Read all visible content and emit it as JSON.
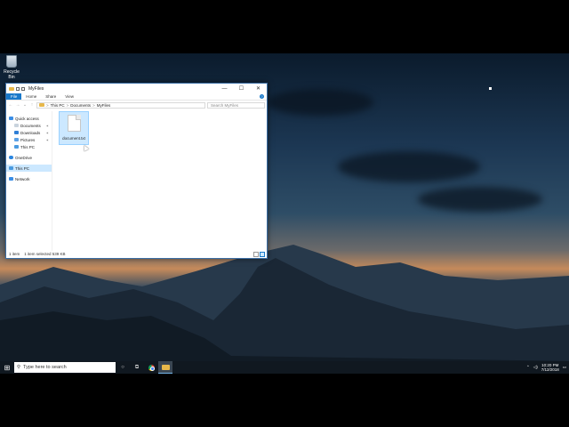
{
  "desktop": {
    "recycle_bin_label": "Recycle Bin"
  },
  "explorer": {
    "title": "MyFiles",
    "window_controls": {
      "minimize": "—",
      "maximize": "☐",
      "close": "✕"
    },
    "ribbon_tabs": [
      "File",
      "Home",
      "Share",
      "View"
    ],
    "help_glyph": "?",
    "nav_glyphs": {
      "back": "←",
      "forward": "→",
      "up_menu": "⌄",
      "up": "↑"
    },
    "address_parts": [
      "This PC",
      "Documents",
      "MyFiles"
    ],
    "address_sep": ">",
    "search_placeholder": "Search MyFiles",
    "nav_items": {
      "quick_access": "Quick access",
      "documents": "Documents",
      "downloads": "Downloads",
      "pictures": "Pictures",
      "this_pc_quick": "This PC",
      "onedrive": "OneDrive",
      "this_pc": "This PC",
      "network": "Network"
    },
    "file": {
      "name": "document.txt"
    },
    "status": {
      "item_count": "1 item",
      "selected": "1 item selected 539 KB"
    }
  },
  "taskbar": {
    "start_glyph": "⊞",
    "search_placeholder": "Type here to search",
    "cortana_glyph": "○",
    "taskview_glyph": "⧉",
    "clock_time": "10:20 PM",
    "clock_date": "7/12/2018"
  }
}
